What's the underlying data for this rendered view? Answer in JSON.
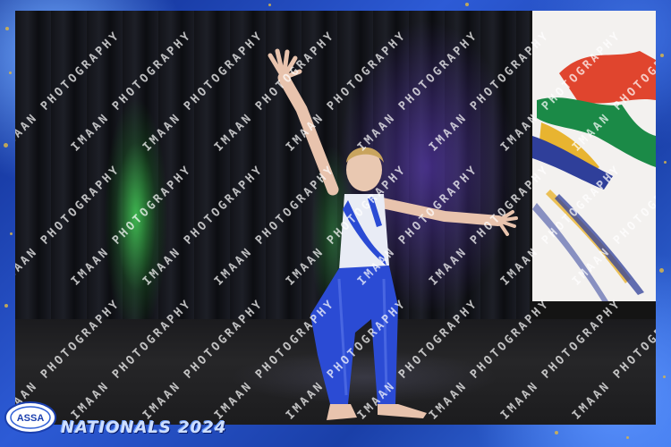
{
  "photo": {
    "logo_text": "ASSA",
    "event_title": "NATIONALS 2024",
    "watermark_text": "IMAAN PHOTOGRAPHY"
  },
  "colors": {
    "frame_blue": "#1b3fae",
    "curtain": "#16171d",
    "costume_blue": "#2b4bd4",
    "costume_white": "#e9ecf5",
    "flag_red": "#e0452e",
    "flag_green": "#1b8a47",
    "flag_blue": "#2f3f9a",
    "flag_gold": "#e8b430"
  }
}
